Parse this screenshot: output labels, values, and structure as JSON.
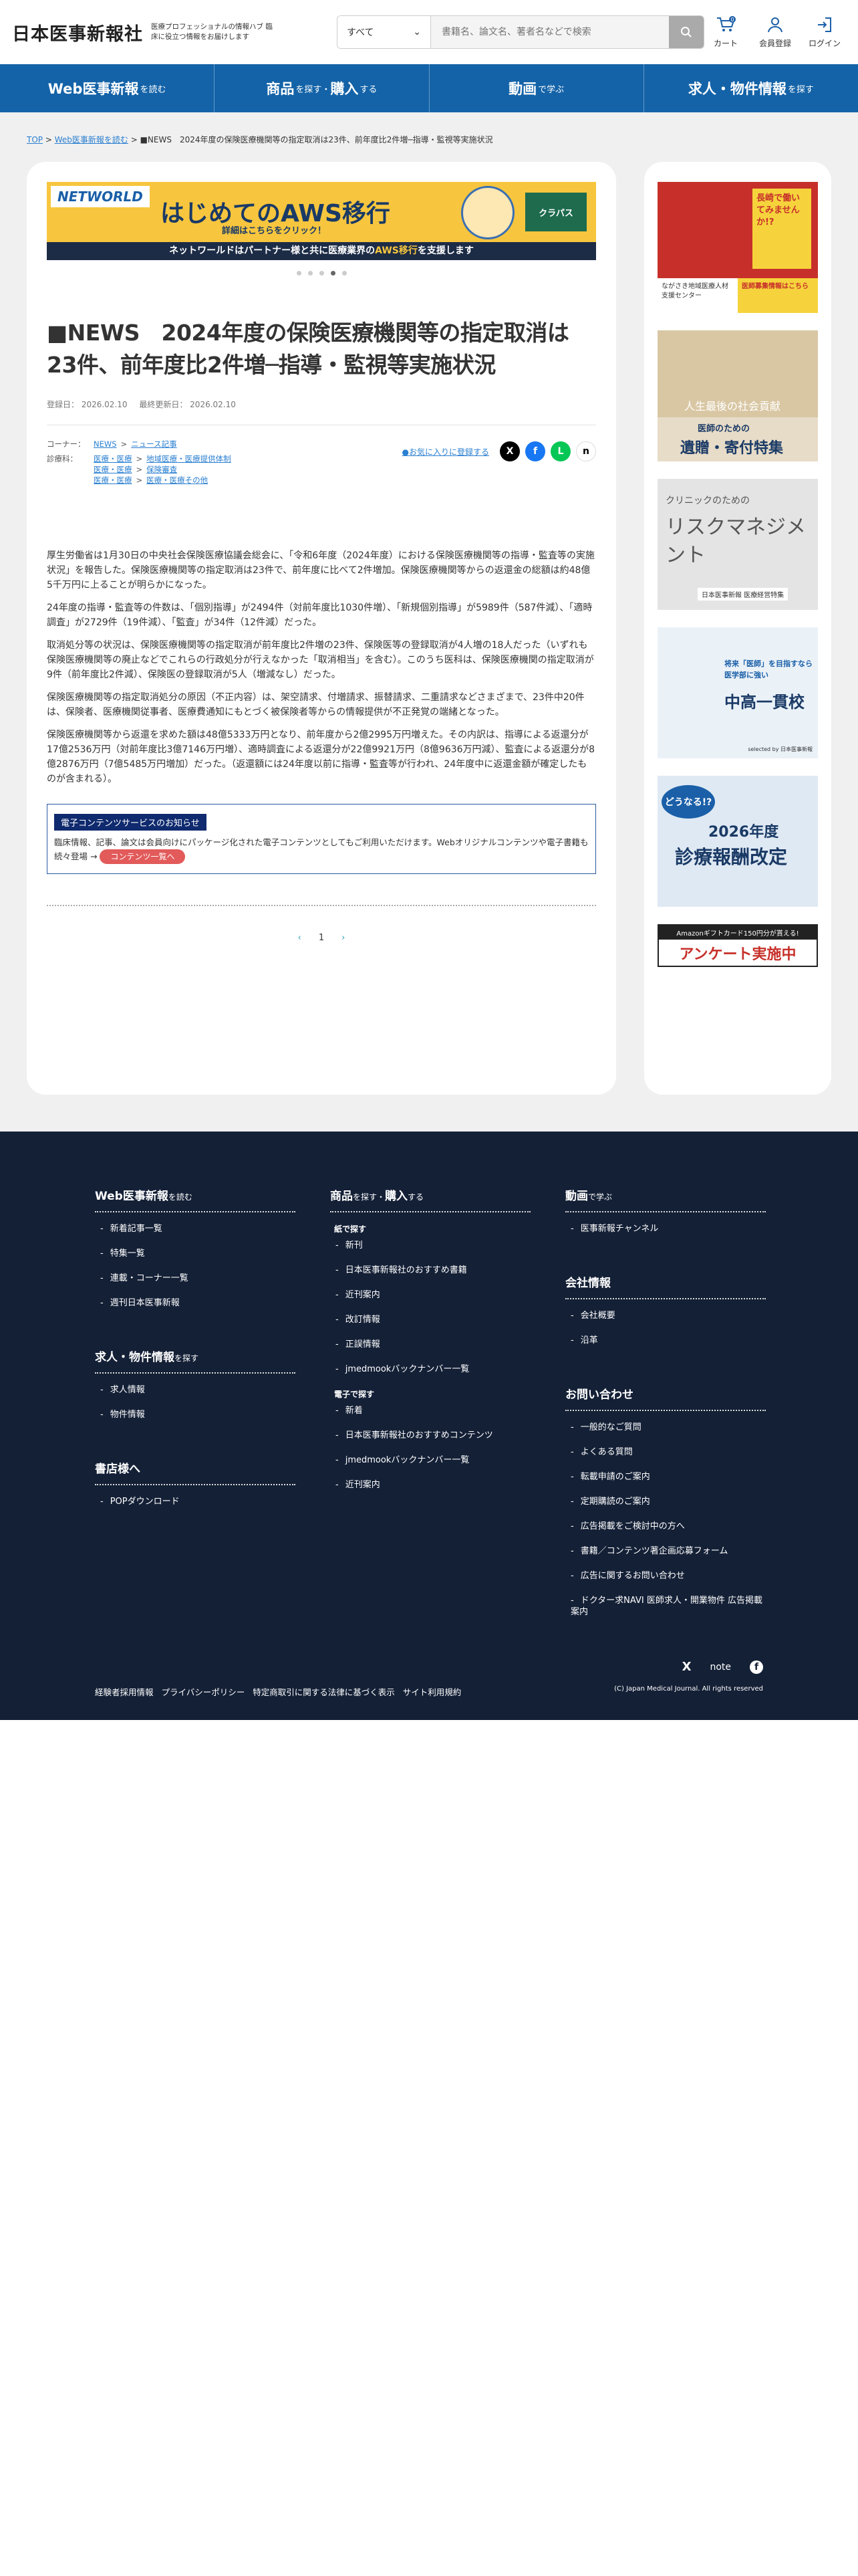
{
  "header": {
    "logo": "日本医事新報社",
    "tagline": "医療プロフェッショナルの情報ハブ 臨床に役立つ情報をお届けします",
    "search_select": "すべて",
    "search_placeholder": "書籍名、論文名、著者名などで検索",
    "cart_label": "カート",
    "cart_count": "0",
    "register_label": "会員登録",
    "login_label": "ログイン"
  },
  "nav": [
    {
      "main": "Web医事新報",
      "sub": "を読む"
    },
    {
      "main": "商品",
      "sub": "を探す・",
      "main2": "購入",
      "sub2": "する"
    },
    {
      "main": "動画",
      "sub": "で学ぶ"
    },
    {
      "main": "求人・物件情報",
      "sub": "を探す"
    }
  ],
  "breadcrumb": {
    "top": "TOP",
    "web": "Web医事新報を読む",
    "current": "■NEWS　2024年度の保険医療機関等の指定取消は23件、前年度比2件増─指導・監視等実施状況"
  },
  "banner": {
    "brand": "NETWORLD",
    "headline": "はじめてのAWS移行",
    "sub": "詳細はこちらをクリック！",
    "partner": "クラパス",
    "bottom_pre": "ネットワールドはパートナー様と共に医療業界の",
    "bottom_em": "AWS移行",
    "bottom_post": "を支援します"
  },
  "article": {
    "title": "■NEWS　2024年度の保険医療機関等の指定取消は23件、前年度比2件増─指導・監視等実施状況",
    "registered": "登録日： 2026.02.10",
    "updated": "最終更新日： 2026.02.10",
    "corner_label": "コーナー：",
    "corner_a": "NEWS",
    "corner_b": "ニュース記事",
    "field_label": "診療科：",
    "fields": [
      [
        "医療・医療",
        "地域医療・医療提供体制"
      ],
      [
        "医療・医療",
        "保険審査"
      ],
      [
        "医療・医療",
        "医療・医療その他"
      ]
    ],
    "favorite": "●お気に入りに登録する",
    "paragraphs": [
      "厚生労働省は1月30日の中央社会保険医療協議会総会に、「令和6年度（2024年度）における保険医療機関等の指導・監査等の実施状況」を報告した。保険医療機関等の指定取消は23件で、前年度に比べて2件増加。保険医療機関等からの返還金の総額は約48億5千万円に上ることが明らかになった。",
      "24年度の指導・監査等の件数は、「個別指導」が2494件（対前年度比1030件増）、「新規個別指導」が5989件（587件減）、「適時調査」が2729件（19件減）、「監査」が34件（12件減）だった。",
      "取消処分等の状況は、保険医療機関等の指定取消が前年度比2件増の23件、保険医等の登録取消が4人増の18人だった（いずれも保険医療機関等の廃止などでこれらの行政処分が行えなかった「取消相当」を含む）。このうち医科は、保険医療機関の指定取消が9件（前年度比2件減）、保険医の登録取消が5人（増減なし）だった。",
      "保険医療機関等の指定取消処分の原因（不正内容）は、架空請求、付増請求、振替請求、二重請求などさまざまで、23件中20件は、保険者、医療機関従事者、医療費通知にもとづく被保険者等からの情報提供が不正発覚の端緒となった。",
      "保険医療機関等から返還を求めた額は48億5333万円となり、前年度から2億2995万円増えた。その内訳は、指導による返還分が17億2536万円（対前年度比3億7146万円増）、適時調査による返還分が22億9921万円（8億9636万円減）、監査による返還分が8億2876万円（7億5485万円増加）だった。（返還額には24年度以前に指導・監査等が行われ、24年度中に返還金額が確定したものが含まれる）。"
    ],
    "notice_head": "電子コンテンツサービスのお知らせ",
    "notice_body": "臨床情報、記事、論文は会員向けにパッケージ化された電子コンテンツとしてもご利用いただけます。Webオリジナルコンテンツや電子書籍も続々登場 →",
    "notice_pill": "コンテンツ一覧へ",
    "page_prev": "‹",
    "page_num": "1",
    "page_next": "›"
  },
  "sidebar": [
    {
      "text": "長崎で働いてみませんか!?",
      "sub": "ながさき地域医療人材支援センター",
      "cta": "医師募集情報はこちら"
    },
    {
      "text": "人生最後の社会貢献",
      "sub": "医師のための",
      "cta": "遺贈・寄付特集"
    },
    {
      "text": "クリニックのための",
      "sub": "リスクマネジメント",
      "cta": "日本医事新報 医療経営特集"
    },
    {
      "text": "将来「医師」を目指すなら 医学部に強い",
      "sub": "中高一貫校",
      "cta": "selected by 日本医事新報"
    },
    {
      "text": "どうなる!?",
      "sub": "2026年度",
      "cta": "診療報酬改定"
    },
    {
      "text": "Amazonギフトカード150円分が貰える!",
      "sub": "アンケート実施中",
      "cta": ""
    }
  ],
  "footer": {
    "col1": {
      "h1": "Web医事新報",
      "h1s": "を読む",
      "items1": [
        "新着記事一覧",
        "特集一覧",
        "連載・コーナー一覧",
        "週刊日本医事新報"
      ],
      "h2": "求人・物件情報",
      "h2s": "を探す",
      "items2": [
        "求人情報",
        "物件情報"
      ],
      "h3": "書店様へ",
      "items3": [
        "POPダウンロード"
      ]
    },
    "col2": {
      "h1": "商品",
      "h1s": "を探す・",
      "h1b": "購入",
      "h1bs": "する",
      "sub1": "紙で探す",
      "items1": [
        "新刊",
        "日本医事新報社のおすすめ書籍",
        "近刊案内",
        "改訂情報",
        "正誤情報",
        "jmedmookバックナンバー一覧"
      ],
      "sub2": "電子で探す",
      "items2": [
        "新着",
        "日本医事新報社のおすすめコンテンツ",
        "jmedmookバックナンバー一覧",
        "近刊案内"
      ]
    },
    "col3": {
      "h1": "動画",
      "h1s": "で学ぶ",
      "items1": [
        "医事新報チャンネル"
      ],
      "h2": "会社情報",
      "items2": [
        "会社概要",
        "沿革"
      ],
      "h3": "お問い合わせ",
      "items3": [
        "一般的なご質問",
        "よくある質問",
        "転載申請のご案内",
        "定期購読のご案内",
        "広告掲載をご検討中の方へ",
        "書籍／コンテンツ著企画応募フォーム",
        "広告に関するお問い合わせ",
        "ドクター求NAVI 医師求人・開業物件 広告掲載案内"
      ]
    },
    "bottom_links": [
      "経験者採用情報",
      "プライバシーポリシー",
      "特定商取引に関する法律に基づく表示",
      "サイト利用規約"
    ],
    "copyright": "(C) Japan Medical Journal. All rights reserved",
    "note": "note"
  },
  "colors": {
    "brand_blue": "#1463a8",
    "footer_bg": "#142036",
    "link": "#2a7fd1"
  }
}
